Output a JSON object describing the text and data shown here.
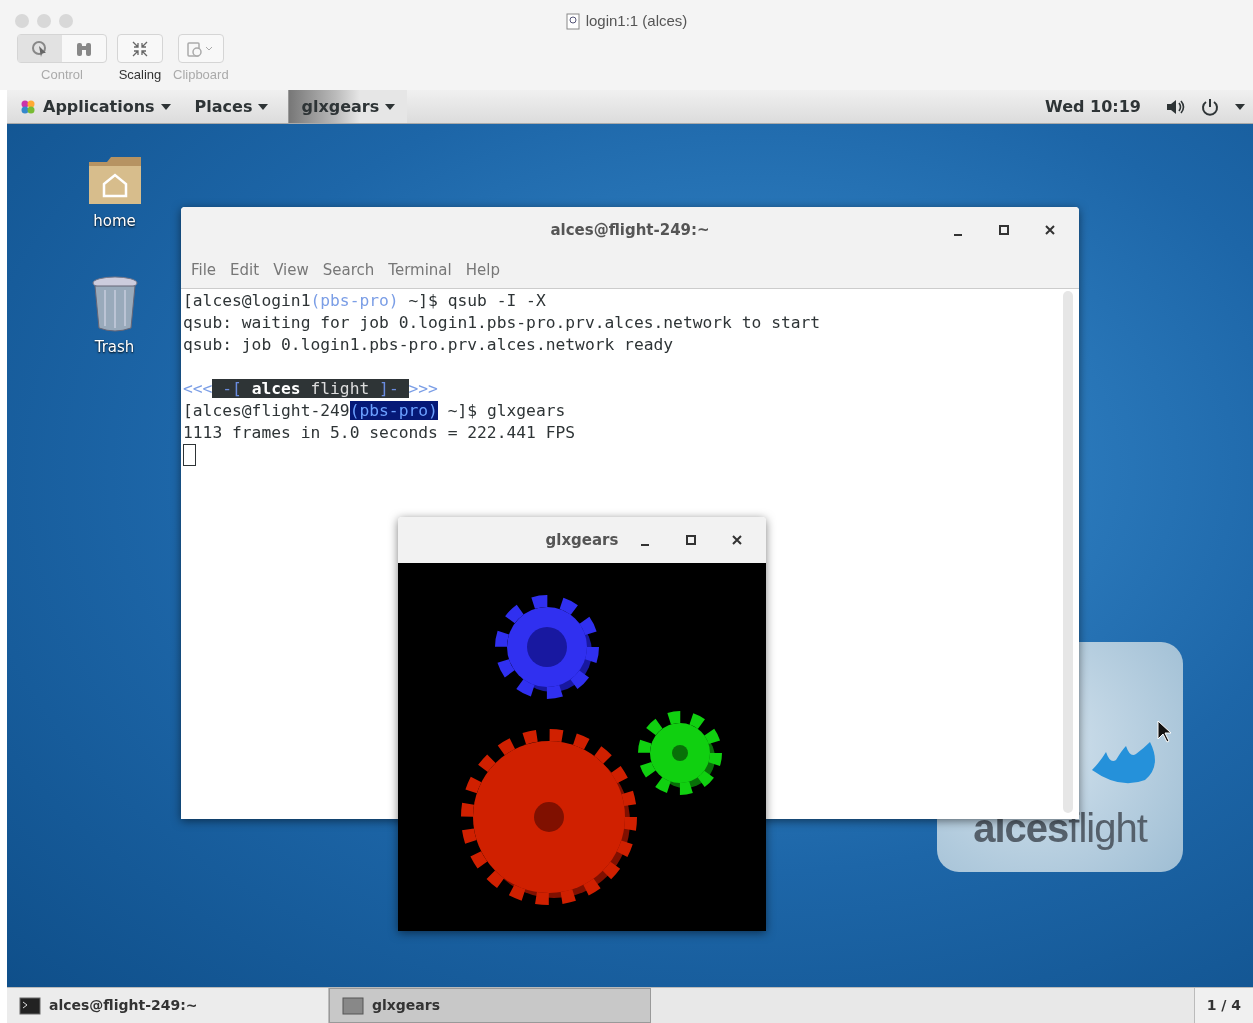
{
  "viewer": {
    "title": "login1:1 (alces)",
    "toolbar": [
      {
        "label": "Control",
        "disabled": true,
        "kind": "control"
      },
      {
        "label": "Scaling",
        "disabled": false,
        "kind": "scaling"
      },
      {
        "label": "Clipboard",
        "disabled": true,
        "kind": "clipboard"
      }
    ]
  },
  "panel": {
    "menus": [
      {
        "label": "Applications",
        "kind": "applications"
      },
      {
        "label": "Places",
        "kind": "places"
      },
      {
        "label": "glxgears",
        "kind": "window"
      }
    ],
    "clock": "Wed 10:19"
  },
  "desktop_icons": [
    {
      "label": "home",
      "kind": "folder"
    },
    {
      "label": "Trash",
      "kind": "trash"
    }
  ],
  "terminal": {
    "title": "alces@flight-249:~",
    "menu": [
      "File",
      "Edit",
      "View",
      "Search",
      "Terminal",
      "Help"
    ],
    "lines": [
      {
        "kind": "text",
        "blank_before": false,
        "segments": [
          {
            "text": "[alces@login1",
            "kind": "plain"
          },
          {
            "text": "(pbs-pro)",
            "kind": "accent"
          },
          {
            "text": " ~]$ qsub -I -X",
            "kind": "plain"
          }
        ]
      },
      {
        "kind": "text",
        "blank_before": false,
        "segments": [
          {
            "text": "qsub: waiting for job 0.login1.pbs-pro.prv.alces.network to start",
            "kind": "plain"
          }
        ]
      },
      {
        "kind": "text",
        "blank_before": false,
        "segments": [
          {
            "text": "qsub: job 0.login1.pbs-pro.prv.alces.network ready",
            "kind": "plain"
          }
        ]
      },
      {
        "kind": "text",
        "blank_before": true,
        "segments": [
          {
            "text": "<<<",
            "kind": "accent"
          },
          {
            "text": " -[ ",
            "kind": "banner-accent"
          },
          {
            "text": "alces",
            "kind": "banner-bold"
          },
          {
            "text": " flight ",
            "kind": "banner"
          },
          {
            "text": "]- ",
            "kind": "banner-accent"
          },
          {
            "text": ">>>",
            "kind": "accent"
          }
        ]
      },
      {
        "kind": "text",
        "blank_before": false,
        "segments": [
          {
            "text": "[alces@flight-249",
            "kind": "plain"
          },
          {
            "text": "(pbs-pro)",
            "kind": "highlight"
          },
          {
            "text": " ~]$ glxgears",
            "kind": "plain"
          }
        ]
      },
      {
        "kind": "text",
        "blank_before": false,
        "segments": [
          {
            "text": "1113 frames in 5.0 seconds = 222.441 FPS",
            "kind": "plain"
          }
        ]
      },
      {
        "kind": "cursor"
      }
    ]
  },
  "gears_window": {
    "title": "glxgears"
  },
  "logo": {
    "text": "**alces**flight"
  },
  "taskbar": {
    "tasks": [
      {
        "label": "alces@flight-249:~",
        "selected": false
      },
      {
        "label": "glxgears",
        "selected": true
      }
    ],
    "workspace": "1 / 4"
  }
}
